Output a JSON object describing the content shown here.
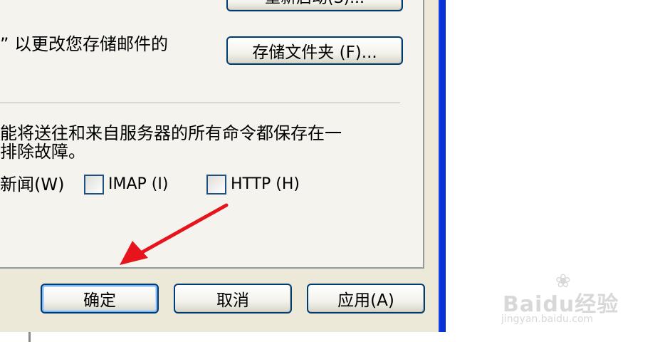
{
  "dialog": {
    "top_button_label": "重新启动(S)...",
    "store_folder_text": "” 以更改您存储邮件的",
    "store_folder_button": "存储文件夹 (F)...",
    "log_text_line1": "能将送往和来自服务器的所有命令都保存在一",
    "log_text_line2": "排除故障。",
    "news_label": "新闻(W)",
    "imap_label": "IMAP (I)",
    "http_label": "HTTP (H)",
    "ok_button": "确定",
    "cancel_button": "取消",
    "apply_button": "应用(A)"
  },
  "watermark": {
    "brand": "Baidu经验",
    "url": "jingyan.baidu.com"
  },
  "colors": {
    "window_border": "#0831d9",
    "button_border": "#003c74",
    "arrow": "#e8141b"
  }
}
